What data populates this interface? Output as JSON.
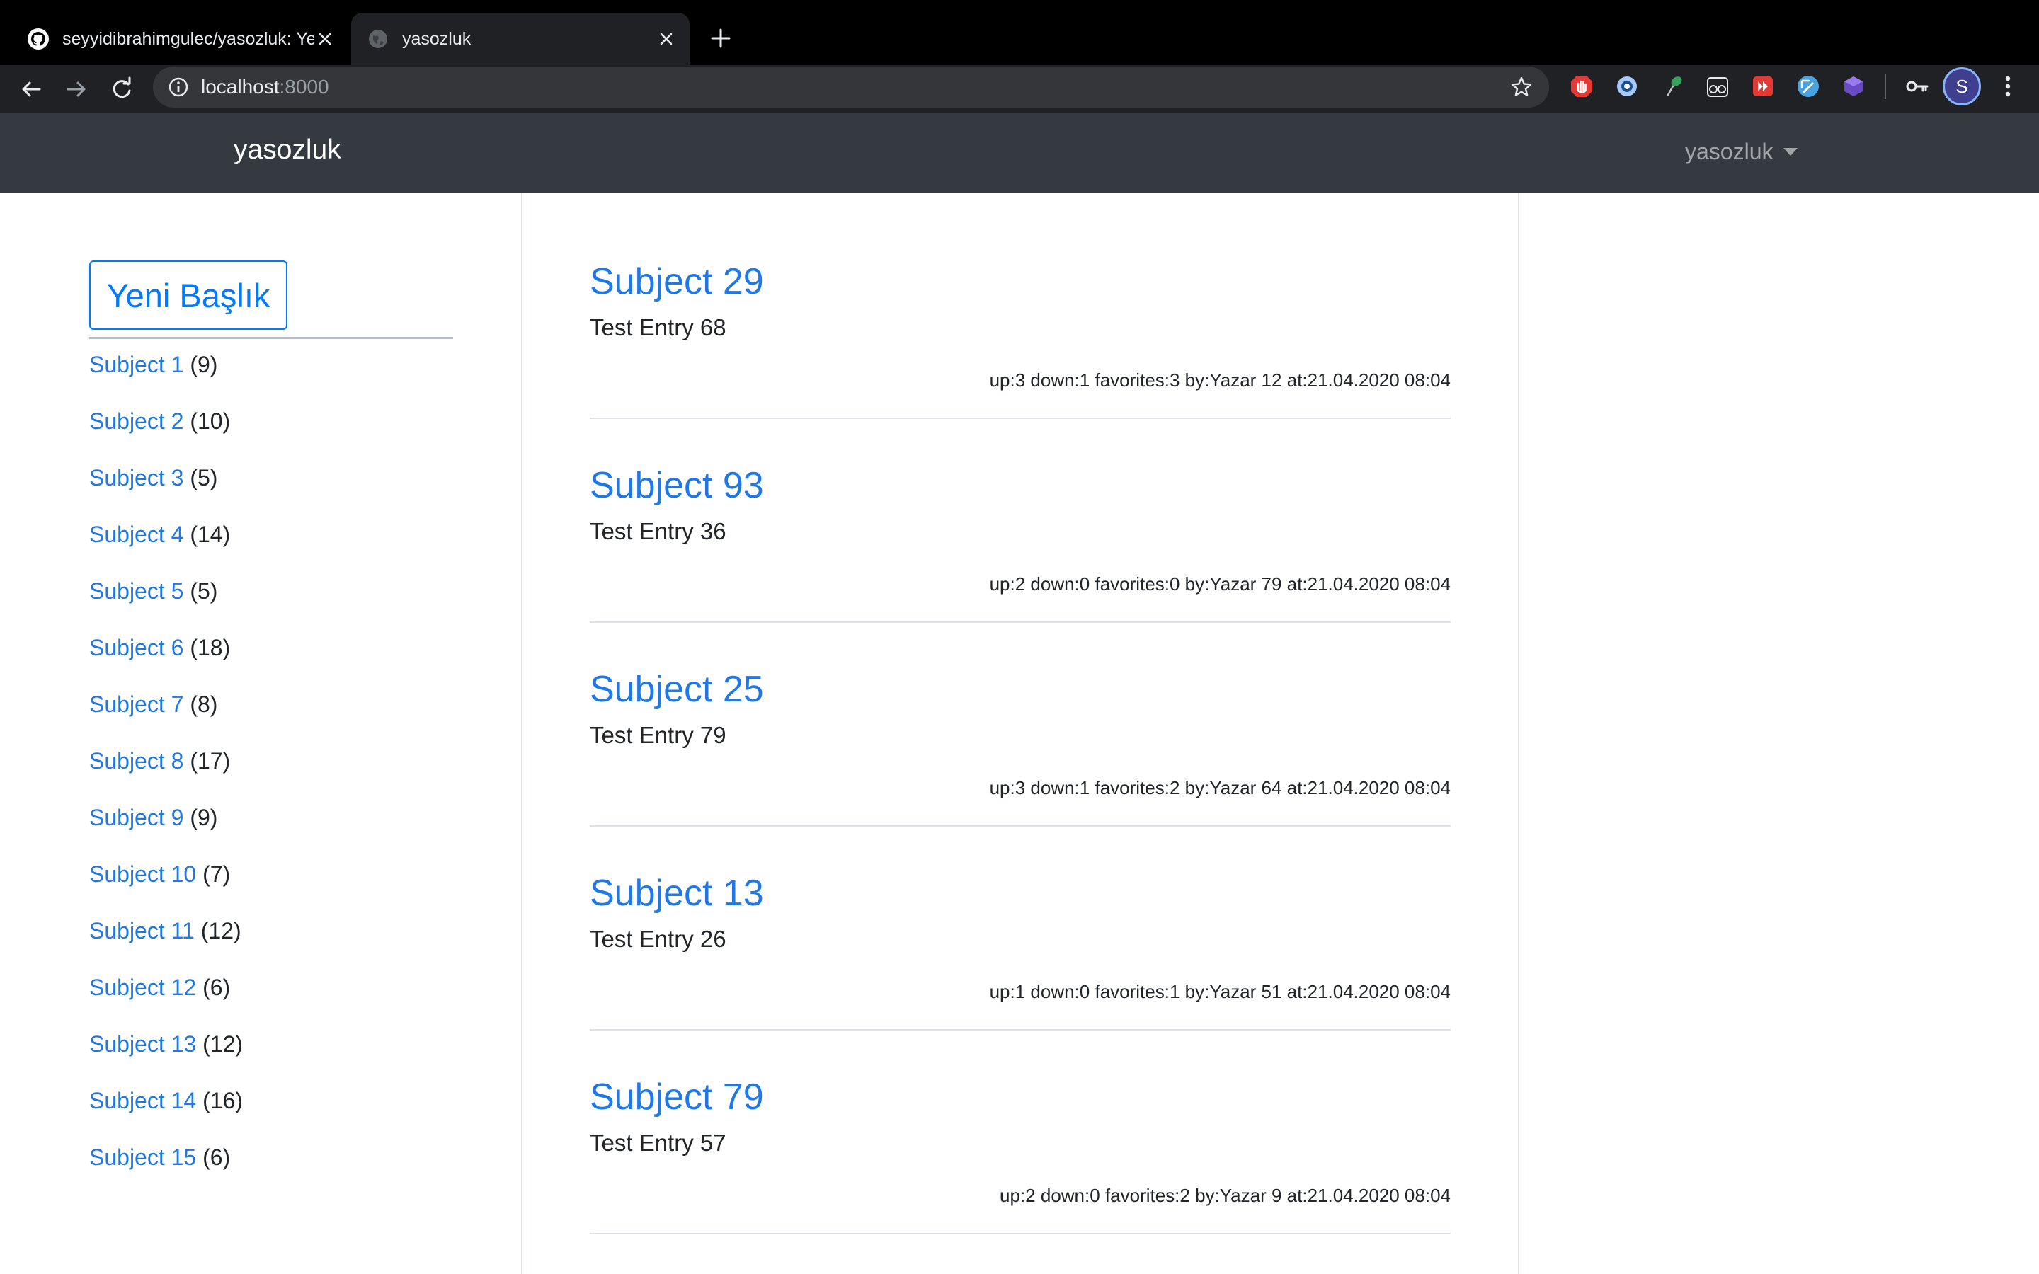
{
  "browser": {
    "tabs": [
      {
        "title": "seyyidibrahimgulec/yasozluk: Ye",
        "favicon": "github-icon",
        "active": false
      },
      {
        "title": "yasozluk",
        "favicon": "globe-icon",
        "active": true
      }
    ],
    "address": {
      "host": "localhost",
      "port": ":8000"
    },
    "extensions": [
      "adblock-icon",
      "privacy-badger-icon",
      "leaf-extension-icon",
      "reader-glasses-icon",
      "media-extension-icon",
      "screenshot-extension-icon",
      "crystal-extension-icon"
    ],
    "profile_initial": "S",
    "accent": "#8ab4f8"
  },
  "navbar": {
    "brand": "yasozluk",
    "user_menu": "yasozluk",
    "background": "#343a40"
  },
  "sidebar": {
    "new_topic_label": "Yeni Başlık",
    "subjects": [
      {
        "name": "Subject 1",
        "count": "(9)"
      },
      {
        "name": "Subject 2",
        "count": "(10)"
      },
      {
        "name": "Subject 3",
        "count": "(5)"
      },
      {
        "name": "Subject 4",
        "count": "(14)"
      },
      {
        "name": "Subject 5",
        "count": "(5)"
      },
      {
        "name": "Subject 6",
        "count": "(18)"
      },
      {
        "name": "Subject 7",
        "count": "(8)"
      },
      {
        "name": "Subject 8",
        "count": "(17)"
      },
      {
        "name": "Subject 9",
        "count": "(9)"
      },
      {
        "name": "Subject 10",
        "count": "(7)"
      },
      {
        "name": "Subject 11",
        "count": "(12)"
      },
      {
        "name": "Subject 12",
        "count": "(6)"
      },
      {
        "name": "Subject 13",
        "count": "(12)"
      },
      {
        "name": "Subject 14",
        "count": "(16)"
      },
      {
        "name": "Subject 15",
        "count": "(6)"
      }
    ]
  },
  "feed": {
    "entries": [
      {
        "subject": "Subject 29",
        "text": "Test Entry 68",
        "meta": "up:3 down:1 favorites:3 by:Yazar 12 at:21.04.2020 08:04"
      },
      {
        "subject": "Subject 93",
        "text": "Test Entry 36",
        "meta": "up:2 down:0 favorites:0 by:Yazar 79 at:21.04.2020 08:04"
      },
      {
        "subject": "Subject 25",
        "text": "Test Entry 79",
        "meta": "up:3 down:1 favorites:2 by:Yazar 64 at:21.04.2020 08:04"
      },
      {
        "subject": "Subject 13",
        "text": "Test Entry 26",
        "meta": "up:1 down:0 favorites:1 by:Yazar 51 at:21.04.2020 08:04"
      },
      {
        "subject": "Subject 79",
        "text": "Test Entry 57",
        "meta": "up:2 down:0 favorites:2 by:Yazar 9 at:21.04.2020 08:04"
      }
    ]
  },
  "colors": {
    "link": "#1f78e6",
    "primary": "#007bff"
  }
}
